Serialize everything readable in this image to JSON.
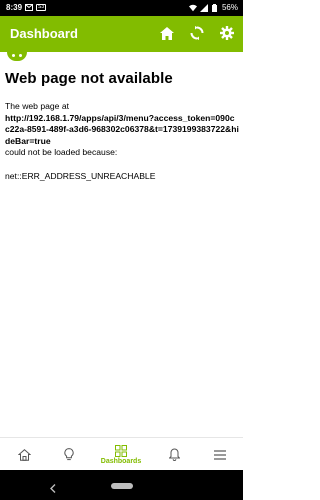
{
  "status_bar": {
    "time": "8:39",
    "badge": "M",
    "badge2": "S3",
    "battery": "56%"
  },
  "app_bar": {
    "title": "Dashboard"
  },
  "error": {
    "title": "Web page not available",
    "intro": "The web page at",
    "url": "http://192.168.1.79/apps/api/3/menu?access_token=090cc22a-8591-489f-a3d6-968302c06378&t=1739199383722&hideBar=true",
    "suffix": "could not be loaded because:",
    "code": "net::ERR_ADDRESS_UNREACHABLE"
  },
  "bottom_nav": {
    "active_label": "Dashboards"
  },
  "colors": {
    "accent": "#82bc00"
  }
}
